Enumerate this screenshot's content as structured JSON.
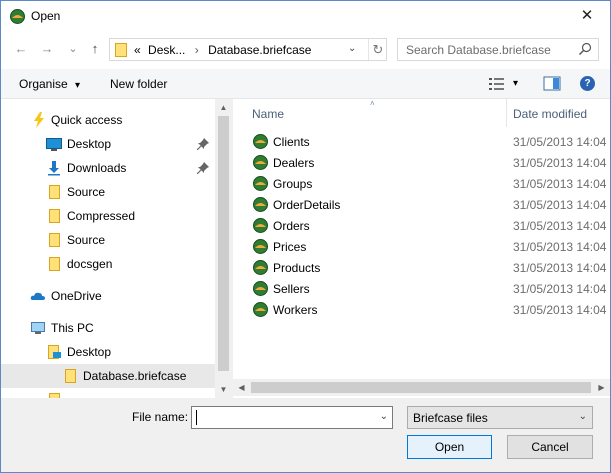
{
  "window": {
    "title": "Open",
    "close_glyph": "✕"
  },
  "nav": {
    "back_glyph": "←",
    "forward_glyph": "→",
    "recent_glyph": "⌄",
    "up_glyph": "↑",
    "address_prefix": "«",
    "breadcrumb_1": "Desk...",
    "breadcrumb_sep": "›",
    "breadcrumb_2": "Database.briefcase",
    "address_dropdown": "⌄",
    "refresh_glyph": "↻",
    "search_placeholder": "Search Database.briefcase"
  },
  "toolbar": {
    "organise_label": "Organise",
    "organise_arrow": "▾",
    "new_folder_label": "New folder",
    "view_arrow": "▾",
    "help_glyph": "?"
  },
  "sidebar": {
    "items": [
      {
        "label": "Quick access",
        "icon": "star-lightning-icon"
      },
      {
        "label": "Desktop",
        "icon": "desktop-icon",
        "pinned": true
      },
      {
        "label": "Downloads",
        "icon": "downloads-icon",
        "pinned": true
      },
      {
        "label": "Source",
        "icon": "folder-icon"
      },
      {
        "label": "Compressed",
        "icon": "folder-icon"
      },
      {
        "label": "Source",
        "icon": "folder-icon"
      },
      {
        "label": "docsgen",
        "icon": "folder-icon"
      },
      {
        "label": "OneDrive",
        "icon": "cloud-icon"
      },
      {
        "label": "This PC",
        "icon": "computer-icon"
      },
      {
        "label": "Desktop",
        "icon": "desktop-folder-icon"
      },
      {
        "label": "Database.briefcase",
        "icon": "folder-icon",
        "selected": true
      }
    ],
    "scroll_up": "▲",
    "scroll_down": "▼"
  },
  "files": {
    "columns": {
      "name": "Name",
      "date": "Date modified",
      "sort_glyph": "˄"
    },
    "rows": [
      {
        "name": "Clients",
        "date": "31/05/2013 14:04"
      },
      {
        "name": "Dealers",
        "date": "31/05/2013 14:04"
      },
      {
        "name": "Groups",
        "date": "31/05/2013 14:04"
      },
      {
        "name": "OrderDetails",
        "date": "31/05/2013 14:04"
      },
      {
        "name": "Orders",
        "date": "31/05/2013 14:04"
      },
      {
        "name": "Prices",
        "date": "31/05/2013 14:04"
      },
      {
        "name": "Products",
        "date": "31/05/2013 14:04"
      },
      {
        "name": "Sellers",
        "date": "31/05/2013 14:04"
      },
      {
        "name": "Workers",
        "date": "31/05/2013 14:04"
      }
    ],
    "scroll_left": "◀",
    "scroll_right": "▶"
  },
  "footer": {
    "file_name_label": "File name:",
    "file_name_value": "",
    "file_name_dropdown": "⌄",
    "file_type_value": "Briefcase files",
    "file_type_dropdown": "⌄",
    "open_label": "Open",
    "cancel_label": "Cancel"
  },
  "colors": {
    "border": "#5b8ac8",
    "accent": "#0078d7",
    "folder": "#ffe17a",
    "briefcase_green": "#2e7d32"
  }
}
